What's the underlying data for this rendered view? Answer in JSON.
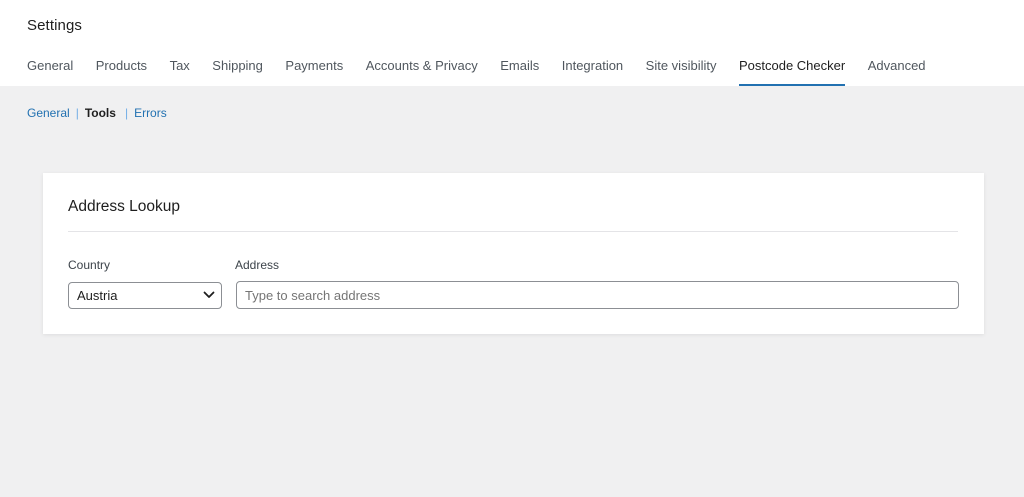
{
  "header": {
    "title": "Settings",
    "tabs": [
      {
        "label": "General"
      },
      {
        "label": "Products"
      },
      {
        "label": "Tax"
      },
      {
        "label": "Shipping"
      },
      {
        "label": "Payments"
      },
      {
        "label": "Accounts & Privacy"
      },
      {
        "label": "Emails"
      },
      {
        "label": "Integration"
      },
      {
        "label": "Site visibility"
      },
      {
        "label": "Postcode Checker",
        "active": true
      },
      {
        "label": "Advanced"
      }
    ]
  },
  "subnav": {
    "items": [
      {
        "label": "General"
      },
      {
        "label": "Tools",
        "current": true
      },
      {
        "label": "Errors"
      }
    ],
    "separator": "|"
  },
  "card": {
    "title": "Address Lookup",
    "country": {
      "label": "Country",
      "selected": "Austria",
      "icon": "chevron-down-icon"
    },
    "address": {
      "label": "Address",
      "value": "",
      "placeholder": "Type to search address"
    }
  },
  "colors": {
    "accent": "#2271b1",
    "page_background": "#f0f0f1",
    "card_background": "#ffffff"
  }
}
